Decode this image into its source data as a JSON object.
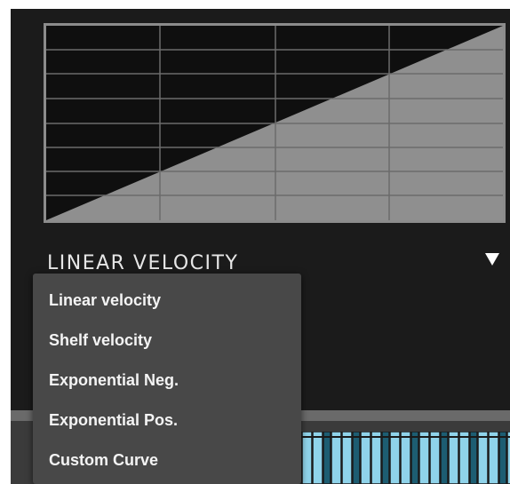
{
  "velocity_curve": {
    "selected_label": "LINEAR VELOCITY",
    "dropdown_icon": "triangle-down",
    "menu_items": [
      "Linear velocity",
      "Shelf velocity",
      "Exponential Neg.",
      "Exponential Pos.",
      "Custom Curve"
    ]
  },
  "colors": {
    "panel_background": "#1b1b1b",
    "graph_fill": "#8f8f8f",
    "graph_grid": "#6b6b6b",
    "menu_background": "#484848",
    "menu_text": "#f4f4f4",
    "key_accent": "#8fd3ea",
    "key_dark": "#1d5d72"
  }
}
